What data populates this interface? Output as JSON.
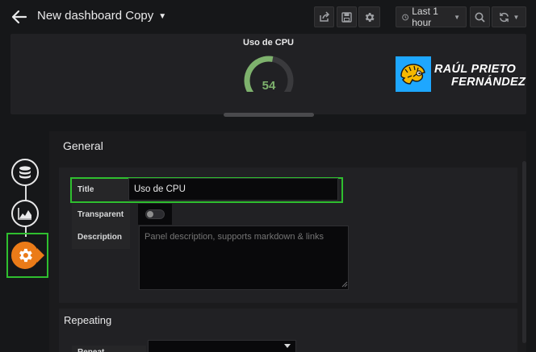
{
  "header": {
    "dashboard_title": "New dashboard Copy",
    "time_range": "Last 1 hour"
  },
  "panel": {
    "title": "Uso de CPU",
    "gauge_value": "54",
    "gauge_fraction": 0.54,
    "colors": {
      "gauge_good": "#7eb26d",
      "gauge_track": "#3a3a3d"
    }
  },
  "logo": {
    "line1": "RAÚL PRIETO",
    "line2": "FERNÁNDEZ",
    "badge_color": "#1ea7ff",
    "icon": "chameleon-logo"
  },
  "rail": {
    "steps": [
      {
        "icon": "database-icon",
        "active": false
      },
      {
        "icon": "area-chart-icon",
        "active": false
      },
      {
        "icon": "settings-gear-icon",
        "active": true
      }
    ],
    "accent": "#eb7b18"
  },
  "editor": {
    "heading": "General",
    "general": {
      "title_label": "Title",
      "title_value": "Uso de CPU",
      "transparent_label": "Transparent",
      "transparent_on": false,
      "description_label": "Description",
      "description_placeholder": "Panel description, supports markdown & links"
    },
    "repeating": {
      "heading": "Repeating",
      "repeat_label": "Repeat"
    }
  },
  "highlight_color": "#2fbf2f"
}
